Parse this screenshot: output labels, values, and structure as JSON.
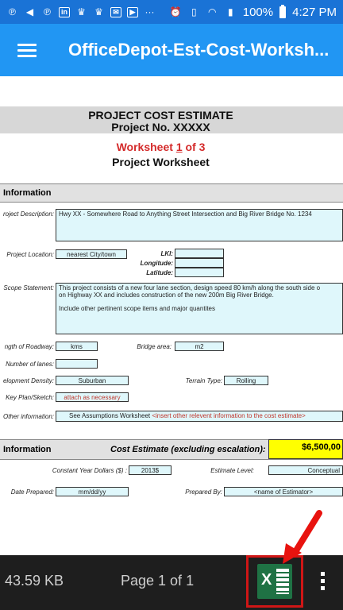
{
  "status_bar": {
    "battery": "100%",
    "time": "4:27 PM"
  },
  "app_bar": {
    "title": "OfficeDepot-Est-Cost-Worksh..."
  },
  "document": {
    "title": "PROJECT COST ESTIMATE",
    "project_no": "Project No. XXXXX",
    "worksheet_prefix": "Worksheet ",
    "worksheet_num": "1",
    "worksheet_suffix": " of 3",
    "worksheet_name": "Project Worksheet",
    "section1": "Information",
    "labels": {
      "project_description": "roject Description:",
      "project_location": "Project Location:",
      "lki": "LKI:",
      "longitude": "Longitude:",
      "latitude": "Latitude:",
      "scope_statement": "Scope Statement:",
      "length_of_roadway": "ngth of Roadway:",
      "bridge_area": "Bridge area:",
      "number_of_lanes": "Number of lanes:",
      "development_density": "elopment Density:",
      "terrain_type": "Terrain Type:",
      "key_plan": "Key Plan/Sketch:",
      "other_information": "Other information:"
    },
    "values": {
      "project_description": "Hwy XX - Somewhere Road to Anything Street Intersection and Big River Bridge No. 1234",
      "project_location": "nearest City/town",
      "scope_line1": "This project consists of a new four lane section, design speed 80 km/h along the south side o",
      "scope_line2": "on Highway XX and includes construction of the new 200m Big River Bridge.",
      "scope_line3": "Include other pertinent scope items and major quantites",
      "length_unit": "kms",
      "bridge_unit": "m2",
      "density": "Suburban",
      "terrain": "Rolling",
      "key_plan": "attach as necessary",
      "other_info_black": "See Assumptions Worksheet ",
      "other_info_red": "<insert other relevent information to the cost estimate>"
    },
    "section2": "Information",
    "cost_estimate_label": "Cost Estimate (excluding escalation):",
    "cost_estimate_value": "$6,500,00",
    "labels2": {
      "constant_year": "Constant Year Dollars ($) :",
      "estimate_level": "Estimate Level:",
      "date_prepared": "Date Prepared:",
      "prepared_by": "Prepared By:"
    },
    "values2": {
      "constant_year": "2013$",
      "estimate_level": "Conceptual",
      "date_prepared": "mm/dd/yy",
      "prepared_by": "<name of Estimator>"
    }
  },
  "bottom_bar": {
    "file_size": "43.59 KB",
    "page_info": "Page 1 of 1"
  },
  "colors": {
    "status_bar": "#1a73d6",
    "app_bar": "#2196f3",
    "field_fill": "#dff7fb",
    "highlight": "#ffff00",
    "excel_green": "#1f7244",
    "annotation_red": "#d01616"
  }
}
